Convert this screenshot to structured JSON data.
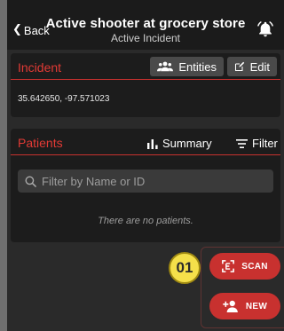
{
  "header": {
    "back_label": "Back",
    "title": "Active shooter at grocery store",
    "subtitle": "Active Incident"
  },
  "incident": {
    "label": "Incident",
    "entities_label": "Entities",
    "edit_label": "Edit",
    "coordinates": "35.642650, -97.571023"
  },
  "patients": {
    "label": "Patients",
    "summary_label": "Summary",
    "filter_label": "Filter",
    "search_placeholder": "Filter by Name or ID",
    "empty_message": "There are no patients."
  },
  "fab": {
    "scan_label": "SCAN",
    "new_label": "NEW"
  },
  "marker": {
    "label": "01"
  },
  "colors": {
    "accent": "#c8312f",
    "card_bg": "#1c1c1c",
    "marker": "#f5e04a"
  },
  "icons": {
    "back": "chevron-left-icon",
    "bell": "bell-icon",
    "entities": "people-icon",
    "edit": "edit-icon",
    "summary": "bar-chart-icon",
    "filter": "filter-icon",
    "search": "search-icon",
    "scan": "scan-icon",
    "new": "add-person-icon"
  }
}
